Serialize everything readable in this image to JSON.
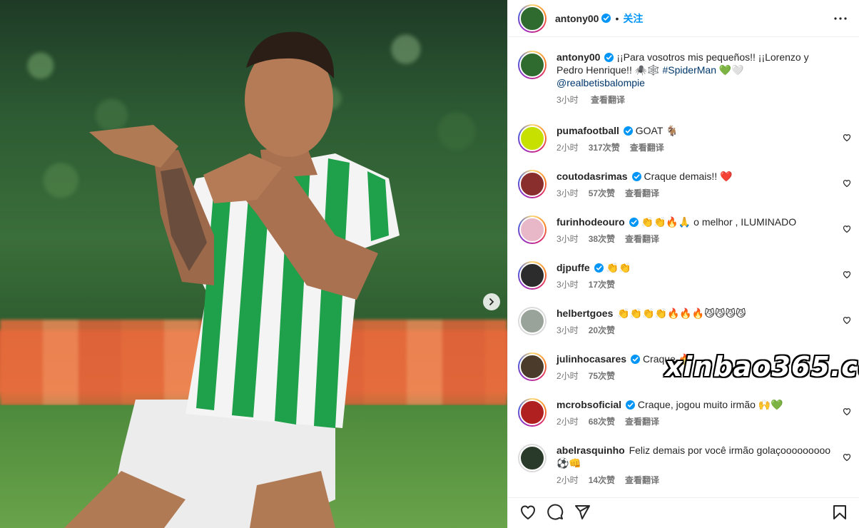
{
  "post": {
    "author": "antony00",
    "follow_label": "关注",
    "caption_parts": {
      "text1": "¡¡Para vosotros mis pequeños!! ¡¡Lorenzo y Pedro Henrique!! ",
      "emoji1": "🕷️🕸️",
      "hashtag": "#SpiderMan",
      "emoji2": "💚🤍",
      "mention": "@realbetisbalompie"
    },
    "time": "3小时",
    "translate_label": "查看翻译"
  },
  "comments": [
    {
      "user": "pumafootball",
      "verified": true,
      "text": "GOAT 🐐",
      "time": "2小时",
      "likes": "317次赞",
      "translate": "查看翻译",
      "avatar_color": "#c8e000"
    },
    {
      "user": "coutodasrimas",
      "verified": true,
      "text": "Craque demais!! ❤️",
      "time": "3小时",
      "likes": "57次赞",
      "translate": "查看翻译",
      "avatar_color": "#8a2d2d"
    },
    {
      "user": "furinhodeouro",
      "verified": true,
      "text": "👏👏🔥🙏 o melhor , ILUMINADO",
      "time": "3小时",
      "likes": "38次赞",
      "translate": "查看翻译",
      "avatar_color": "#e9b8c8"
    },
    {
      "user": "djpuffe",
      "verified": true,
      "text": "👏👏",
      "time": "3小时",
      "likes": "17次赞",
      "translate": "",
      "avatar_color": "#2c2c2c"
    },
    {
      "user": "helbertgoes",
      "verified": false,
      "text": "👏👏👏👏🔥🔥🔥😼😼😼😼",
      "time": "3小时",
      "likes": "20次赞",
      "translate": "",
      "avatar_color": "#9aa39a"
    },
    {
      "user": "julinhocasares",
      "verified": true,
      "text": "Craque 🔥",
      "time": "2小时",
      "likes": "75次赞",
      "translate": "",
      "avatar_color": "#4a3b2a"
    },
    {
      "user": "mcrobsoficial",
      "verified": true,
      "text": "Craque, jogou muito irmão 🙌💚",
      "time": "2小时",
      "likes": "68次赞",
      "translate": "查看翻译",
      "avatar_color": "#b02020"
    },
    {
      "user": "abelrasquinho",
      "verified": false,
      "text": "Feliz demais por você irmão golaçooooooooo ⚽👊",
      "time": "2小时",
      "likes": "14次赞",
      "translate": "查看翻译",
      "avatar_color": "#2a3a2a"
    }
  ],
  "watermark": "xinbao365.cc",
  "icons": {
    "verified": "verified-badge-icon",
    "more": "more-options-icon",
    "like": "heart-icon",
    "comment": "comment-icon",
    "share": "share-icon",
    "save": "bookmark-icon",
    "next": "chevron-right-icon"
  },
  "colors": {
    "accent": "#0095f6",
    "link": "#00376b",
    "muted": "#737373"
  }
}
